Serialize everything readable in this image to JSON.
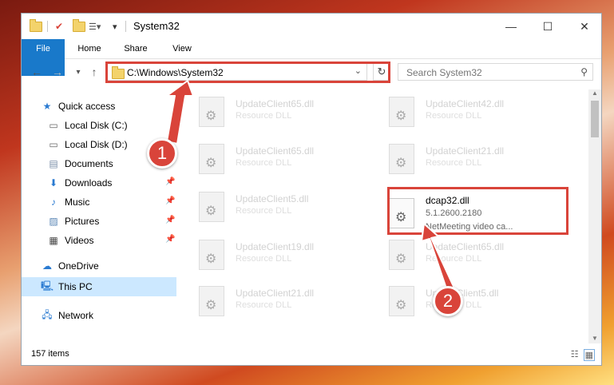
{
  "window": {
    "title": "System32",
    "controls": {
      "minimize": "—",
      "maximize": "☐",
      "close": "✕"
    }
  },
  "ribbon": {
    "tabs": [
      "File",
      "Home",
      "Share",
      "View"
    ]
  },
  "address": {
    "path": "C:\\Windows\\System32",
    "search_placeholder": "Search System32"
  },
  "nav": {
    "items": [
      {
        "label": "Quick access",
        "icon": "star-icon",
        "pinned": false
      },
      {
        "label": "Local Disk (C:)",
        "icon": "drive-icon",
        "pinned": false
      },
      {
        "label": "Local Disk (D:)",
        "icon": "drive-icon",
        "pinned": false
      },
      {
        "label": "Documents",
        "icon": "documents-icon",
        "pinned": true
      },
      {
        "label": "Downloads",
        "icon": "download-icon",
        "pinned": true
      },
      {
        "label": "Music",
        "icon": "music-icon",
        "pinned": true
      },
      {
        "label": "Pictures",
        "icon": "pictures-icon",
        "pinned": true
      },
      {
        "label": "Videos",
        "icon": "videos-icon",
        "pinned": true
      },
      {
        "label": "OneDrive",
        "icon": "cloud-icon",
        "pinned": false
      },
      {
        "label": "This PC",
        "icon": "computer-icon",
        "pinned": false
      },
      {
        "label": "Network",
        "icon": "network-icon",
        "pinned": false
      }
    ]
  },
  "files": [
    {
      "name": "UpdateClient65.dll",
      "desc": "Resource DLL"
    },
    {
      "name": "UpdateClient42.dll",
      "desc": "Resource DLL"
    },
    {
      "name": "UpdateClient65.dll",
      "desc": "Resource DLL"
    },
    {
      "name": "UpdateClient21.dll",
      "desc": "Resource DLL"
    },
    {
      "name": "UpdateClient5.dll",
      "desc": "Resource DLL"
    },
    {
      "name": "dcap32.dll",
      "version": "5.1.2600.2180",
      "desc": "NetMeeting video ca..."
    },
    {
      "name": "UpdateClient19.dll",
      "desc": "Resource DLL"
    },
    {
      "name": "UpdateClient65.dll",
      "desc": "Resource DLL"
    },
    {
      "name": "UpdateClient21.dll",
      "desc": "Resource DLL"
    },
    {
      "name": "UpdateClient5.dll",
      "desc": "Resource DLL"
    }
  ],
  "status": {
    "count": "157 items"
  },
  "annotations": {
    "step1": "1",
    "step2": "2",
    "color": "#d9443a"
  }
}
